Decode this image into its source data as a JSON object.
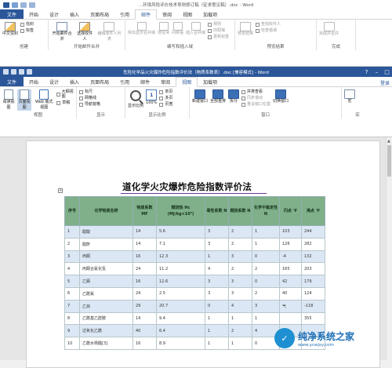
{
  "win1": {
    "title": "…环境风险评价技术导则修订稿（征求意见稿）.doc - Word",
    "tabs": [
      "文件",
      "开始",
      "设计",
      "插入",
      "页面布局",
      "引用",
      "邮件",
      "审阅",
      "视图",
      "加载项"
    ],
    "active_tab": "邮件",
    "groups": {
      "create": {
        "label": "创建",
        "buttons": [
          "中文信封",
          "信封",
          "标签"
        ]
      },
      "start_merge": {
        "label": "开始邮件合并",
        "buttons": [
          "开始邮件合并",
          "选择收件人",
          "编辑收件人列表"
        ]
      },
      "write_insert": {
        "label": "编写和插入域",
        "buttons": [
          "突出显示合并域",
          "地址块",
          "问候语",
          "插入合并域",
          "规则",
          "匹配域",
          "更新标签"
        ]
      },
      "preview": {
        "label": "预览结果",
        "buttons": [
          "预览结果",
          "查找收件人",
          "检查错误"
        ]
      },
      "finish": {
        "label": "完成",
        "buttons": [
          "完成并合并"
        ]
      }
    }
  },
  "win2": {
    "title": "危险化学品火灾爆炸危险指数评价法（物质系数表）.doc [兼容模式] - Word",
    "tabs": [
      "文件",
      "开始",
      "设计",
      "插入",
      "页面布局",
      "引用",
      "邮件",
      "审阅",
      "视图",
      "加载项"
    ],
    "active_tab": "视图",
    "login": "登录",
    "groups": {
      "views": {
        "label": "视图",
        "buttons": [
          "阅读视图",
          "页面视图",
          "Web 版式视图",
          "大纲视图",
          "草稿"
        ]
      },
      "show": {
        "label": "显示",
        "buttons": [
          "标尺",
          "网格线",
          "导航窗格"
        ]
      },
      "zoom": {
        "label": "显示比例",
        "buttons": [
          "显示比例",
          "100%",
          "单页",
          "多页",
          "页宽"
        ]
      },
      "window": {
        "label": "窗口",
        "buttons": [
          "新建窗口",
          "全部重排",
          "拆分",
          "并排查看",
          "同步滚动",
          "重设窗口位置",
          "切换窗口"
        ]
      },
      "macro": {
        "label": "宏",
        "buttons": [
          "宏"
        ]
      }
    }
  },
  "document": {
    "title": "危险化学品火灾爆炸危险指数评价法",
    "title_visible": "道化学火灾爆炸危险指数评价法",
    "table": {
      "headers": [
        "序号",
        "化学物质名称",
        "物质系数 MF",
        "燃烧热 Hc (MJ/kg×10³)",
        "毒性系数 N",
        "燃烧系数 N",
        "化学不稳定性 N",
        "闪点 ℉",
        "沸点 ℉"
      ],
      "rows": [
        [
          "1",
          "醋酸",
          "14",
          "5.6",
          "3",
          "2",
          "1",
          "103",
          "244"
        ],
        [
          "2",
          "醋酐",
          "14",
          "7.1",
          "3",
          "2",
          "1",
          "126",
          "282"
        ],
        [
          "3",
          "丙酮",
          "16",
          "12.3",
          "1",
          "3",
          "0",
          "-4",
          "132"
        ],
        [
          "4",
          "丙酮合氰化氢",
          "24",
          "11.2",
          "4",
          "2",
          "2",
          "165",
          "203"
        ],
        [
          "5",
          "乙腈",
          "16",
          "12.6",
          "3",
          "3",
          "0",
          "42",
          "179"
        ],
        [
          "6",
          "乙酰氯",
          "24",
          "2.5",
          "3",
          "3",
          "2",
          "40",
          "124"
        ],
        [
          "7",
          "乙炔",
          "29",
          "20.7",
          "0",
          "4",
          "3",
          "气",
          "-118"
        ],
        [
          "8",
          "乙酰基乙醇胺",
          "14",
          "9.4",
          "1",
          "1",
          "1",
          "",
          "355"
        ],
        [
          "9",
          "过氧化乙酰",
          "40",
          "6.4",
          "1",
          "2",
          "4",
          "",
          ""
        ],
        [
          "10",
          "乙酰水杨酸[3]",
          "16",
          "8.9",
          "1",
          "1",
          "0",
          "",
          ""
        ]
      ]
    }
  },
  "watermark": {
    "title": "纯净系统之家",
    "url": "www.ycwjsy.com"
  },
  "colors": {
    "accent": "#2b579a",
    "table_header": "#7fb08a",
    "row_alt": "#dbe7f4"
  }
}
